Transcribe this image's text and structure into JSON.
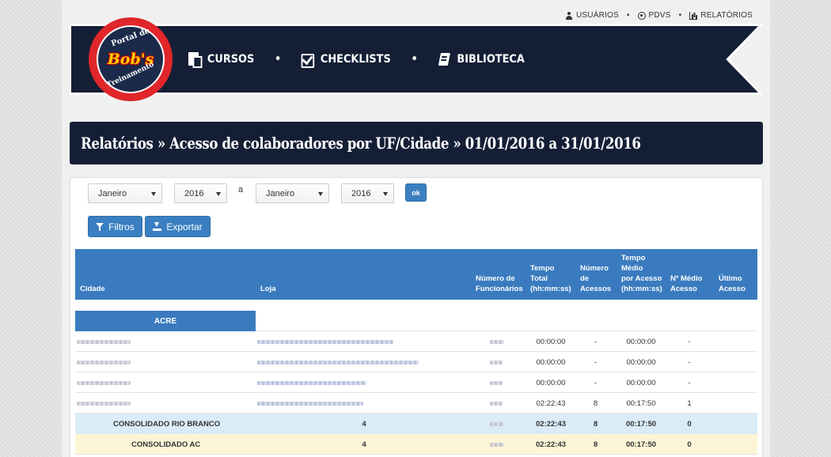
{
  "top_links": [
    {
      "label": "USUÁRIOS",
      "icon": "user-icon"
    },
    {
      "label": "PDVS",
      "icon": "target-icon"
    },
    {
      "label": "RELATÓRIOS",
      "icon": "bar-chart-icon"
    }
  ],
  "logo": {
    "top": "Portal de",
    "brand": "Bob's",
    "bottom": "Treinamento"
  },
  "nav": {
    "cursos": "CURSOS",
    "checklists": "CHECKLISTS",
    "biblioteca": "BIBLIOTECA"
  },
  "page_title": "Relatórios » Acesso de colaboradores por UF/Cidade » 01/01/2016 a 31/01/2016",
  "filters": {
    "month_from": "Janeiro",
    "year_from": "2016",
    "separator": "a",
    "month_to": "Janeiro",
    "year_to": "2016",
    "ok_label": "ok",
    "filtros_label": "Filtros",
    "exportar_label": "Exportar"
  },
  "table": {
    "headers": {
      "cidade": "Cidade",
      "loja": "Loja",
      "num_func": [
        "Número de",
        "Funcionários"
      ],
      "tempo_total": [
        "Tempo",
        "Total",
        "(hh:mm:ss)"
      ],
      "num_acessos": [
        "Número",
        "de",
        "Acessos"
      ],
      "tempo_medio": [
        "Tempo",
        "Médio",
        "por Acesso",
        "(hh:mm:ss)"
      ],
      "medio_acesso": [
        "Nº Médio",
        "Acesso"
      ],
      "ultimo_acesso": [
        "Último",
        "Acesso"
      ]
    },
    "uf": "ACRE",
    "rows": [
      {
        "tempo_total": "00:00:00",
        "acessos": "-",
        "tempo_medio": "00:00:00",
        "medio": "-"
      },
      {
        "tempo_total": "00:00:00",
        "acessos": "-",
        "tempo_medio": "00:00:00",
        "medio": "-"
      },
      {
        "tempo_total": "00:00:00",
        "acessos": "-",
        "tempo_medio": "00:00:00",
        "medio": "-"
      },
      {
        "tempo_total": "02:22:43",
        "acessos": "8",
        "tempo_medio": "00:17:50",
        "medio": "1"
      }
    ],
    "consolidado_cidade": {
      "label": "CONSOLIDADO RIO BRANCO",
      "lojas": "4",
      "tempo_total": "02:22:43",
      "acessos": "8",
      "tempo_medio": "00:17:50",
      "medio": "0"
    },
    "consolidado_uf": {
      "label": "CONSOLIDADO AC",
      "lojas": "4",
      "tempo_total": "02:22:43",
      "acessos": "8",
      "tempo_medio": "00:17:50",
      "medio": "0"
    }
  }
}
